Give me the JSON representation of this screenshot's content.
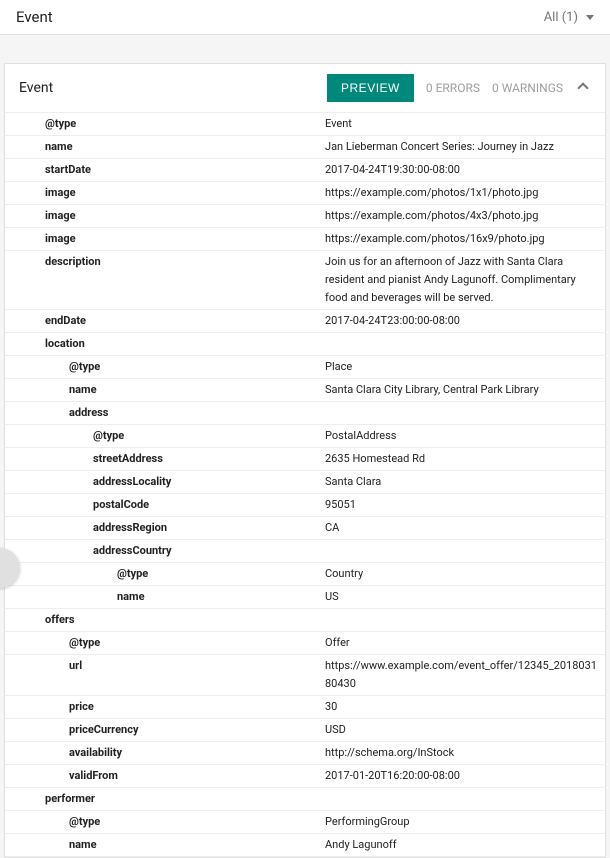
{
  "header": {
    "title": "Event",
    "filter_label": "All (1)"
  },
  "card": {
    "title": "Event",
    "preview_label": "PREVIEW",
    "errors_label": "0 ERRORS",
    "warnings_label": "0 WARNINGS"
  },
  "rows": [
    {
      "indent": 1,
      "key": "@type",
      "value": "Event"
    },
    {
      "indent": 1,
      "key": "name",
      "value": "Jan Lieberman Concert Series: Journey in Jazz"
    },
    {
      "indent": 1,
      "key": "startDate",
      "value": "2017-04-24T19:30:00-08:00"
    },
    {
      "indent": 1,
      "key": "image",
      "value": "https://example.com/photos/1x1/photo.jpg"
    },
    {
      "indent": 1,
      "key": "image",
      "value": "https://example.com/photos/4x3/photo.jpg"
    },
    {
      "indent": 1,
      "key": "image",
      "value": "https://example.com/photos/16x9/photo.jpg"
    },
    {
      "indent": 1,
      "key": "description",
      "value": "Join us for an afternoon of Jazz with Santa Clara resident and pianist Andy Lagunoff. Complimentary food and beverages will be served."
    },
    {
      "indent": 1,
      "key": "endDate",
      "value": "2017-04-24T23:00:00-08:00"
    },
    {
      "indent": 1,
      "key": "location",
      "value": ""
    },
    {
      "indent": 2,
      "key": "@type",
      "value": "Place"
    },
    {
      "indent": 2,
      "key": "name",
      "value": "Santa Clara City Library, Central Park Library"
    },
    {
      "indent": 2,
      "key": "address",
      "value": ""
    },
    {
      "indent": 3,
      "key": "@type",
      "value": "PostalAddress"
    },
    {
      "indent": 3,
      "key": "streetAddress",
      "value": "2635 Homestead Rd"
    },
    {
      "indent": 3,
      "key": "addressLocality",
      "value": "Santa Clara"
    },
    {
      "indent": 3,
      "key": "postalCode",
      "value": "95051"
    },
    {
      "indent": 3,
      "key": "addressRegion",
      "value": "CA"
    },
    {
      "indent": 3,
      "key": "addressCountry",
      "value": ""
    },
    {
      "indent": 4,
      "key": "@type",
      "value": "Country"
    },
    {
      "indent": 4,
      "key": "name",
      "value": "US"
    },
    {
      "indent": 1,
      "key": "offers",
      "value": ""
    },
    {
      "indent": 2,
      "key": "@type",
      "value": "Offer"
    },
    {
      "indent": 2,
      "key": "url",
      "value": "https://www.example.com/event_offer/12345_201803180430"
    },
    {
      "indent": 2,
      "key": "price",
      "value": "30"
    },
    {
      "indent": 2,
      "key": "priceCurrency",
      "value": "USD"
    },
    {
      "indent": 2,
      "key": "availability",
      "value": "http://schema.org/InStock"
    },
    {
      "indent": 2,
      "key": "validFrom",
      "value": "2017-01-20T16:20:00-08:00"
    },
    {
      "indent": 1,
      "key": "performer",
      "value": ""
    },
    {
      "indent": 2,
      "key": "@type",
      "value": "PerformingGroup"
    },
    {
      "indent": 2,
      "key": "name",
      "value": "Andy Lagunoff"
    }
  ]
}
